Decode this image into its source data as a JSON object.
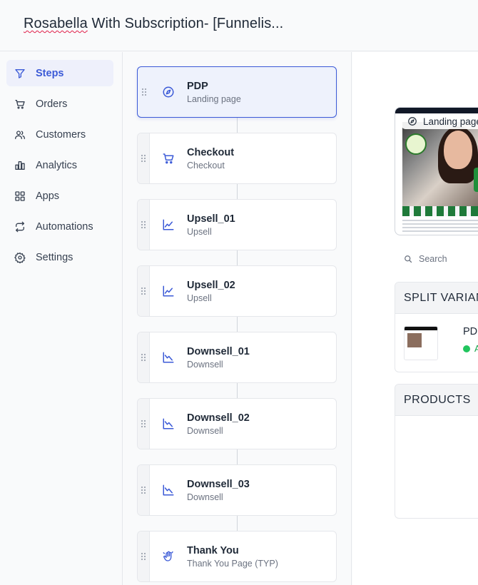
{
  "header": {
    "title_word": "Rosabella",
    "title_rest": " With Subscription- [Funnelis..."
  },
  "sidebar": {
    "items": [
      {
        "label": "Steps",
        "icon": "filter-icon",
        "active": true
      },
      {
        "label": "Orders",
        "icon": "cart-icon"
      },
      {
        "label": "Customers",
        "icon": "users-icon"
      },
      {
        "label": "Analytics",
        "icon": "bar-chart-icon"
      },
      {
        "label": "Apps",
        "icon": "grid-icon"
      },
      {
        "label": "Automations",
        "icon": "repeat-icon"
      },
      {
        "label": "Settings",
        "icon": "gear-icon"
      }
    ]
  },
  "steps": [
    {
      "name": "PDP",
      "subtitle": "Landing page",
      "icon": "compass-icon",
      "active": true
    },
    {
      "name": "Checkout",
      "subtitle": "Checkout",
      "icon": "cart-icon"
    },
    {
      "name": "Upsell_01",
      "subtitle": "Upsell",
      "icon": "trending-up-icon"
    },
    {
      "name": "Upsell_02",
      "subtitle": "Upsell",
      "icon": "trending-up-icon"
    },
    {
      "name": "Downsell_01",
      "subtitle": "Downsell",
      "icon": "trending-down-icon"
    },
    {
      "name": "Downsell_02",
      "subtitle": "Downsell",
      "icon": "trending-down-icon"
    },
    {
      "name": "Downsell_03",
      "subtitle": "Downsell",
      "icon": "trending-down-icon"
    },
    {
      "name": "Thank You",
      "subtitle": "Thank You Page (TYP)",
      "icon": "hand-wave-icon"
    }
  ],
  "main": {
    "preview_tag": "Landing page",
    "search_placeholder": "Search",
    "split_variants": {
      "heading": "SPLIT VARIAN",
      "variant_name": "PDI",
      "variant_status": "A"
    },
    "products": {
      "heading": "PRODUCTS"
    }
  },
  "colors": {
    "accent": "#3b5ad7",
    "active_bg": "#eef0fb",
    "status_green": "#22c55e"
  }
}
